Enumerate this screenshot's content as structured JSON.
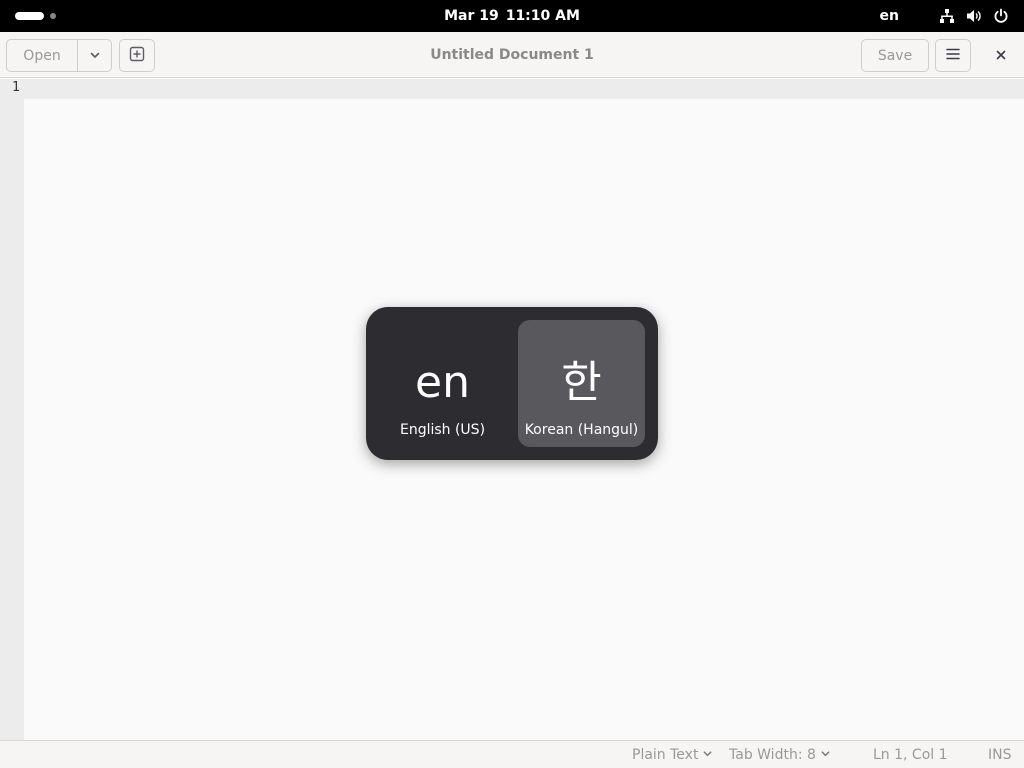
{
  "topbar": {
    "date": "Mar 19",
    "time": "11:10 AM",
    "input_language": "en",
    "icons": [
      "network-icon",
      "volume-icon",
      "power-icon"
    ]
  },
  "header": {
    "open_label": "Open",
    "title": "Untitled Document 1",
    "save_label": "Save"
  },
  "editor": {
    "line_numbers": [
      "1"
    ],
    "content": ""
  },
  "status": {
    "language": "Plain Text",
    "tab_width": "Tab Width: 8",
    "position": "Ln 1, Col 1",
    "mode": "INS"
  },
  "input_switcher": {
    "sources": [
      {
        "glyph": "en",
        "name": "English (US)",
        "selected": false
      },
      {
        "glyph": "한",
        "name": "Korean (Hangul)",
        "selected": true
      }
    ]
  },
  "colors": {
    "switcher_bg": "#2d2c30",
    "switcher_selected": "#59585d",
    "topbar_bg": "#000000"
  }
}
